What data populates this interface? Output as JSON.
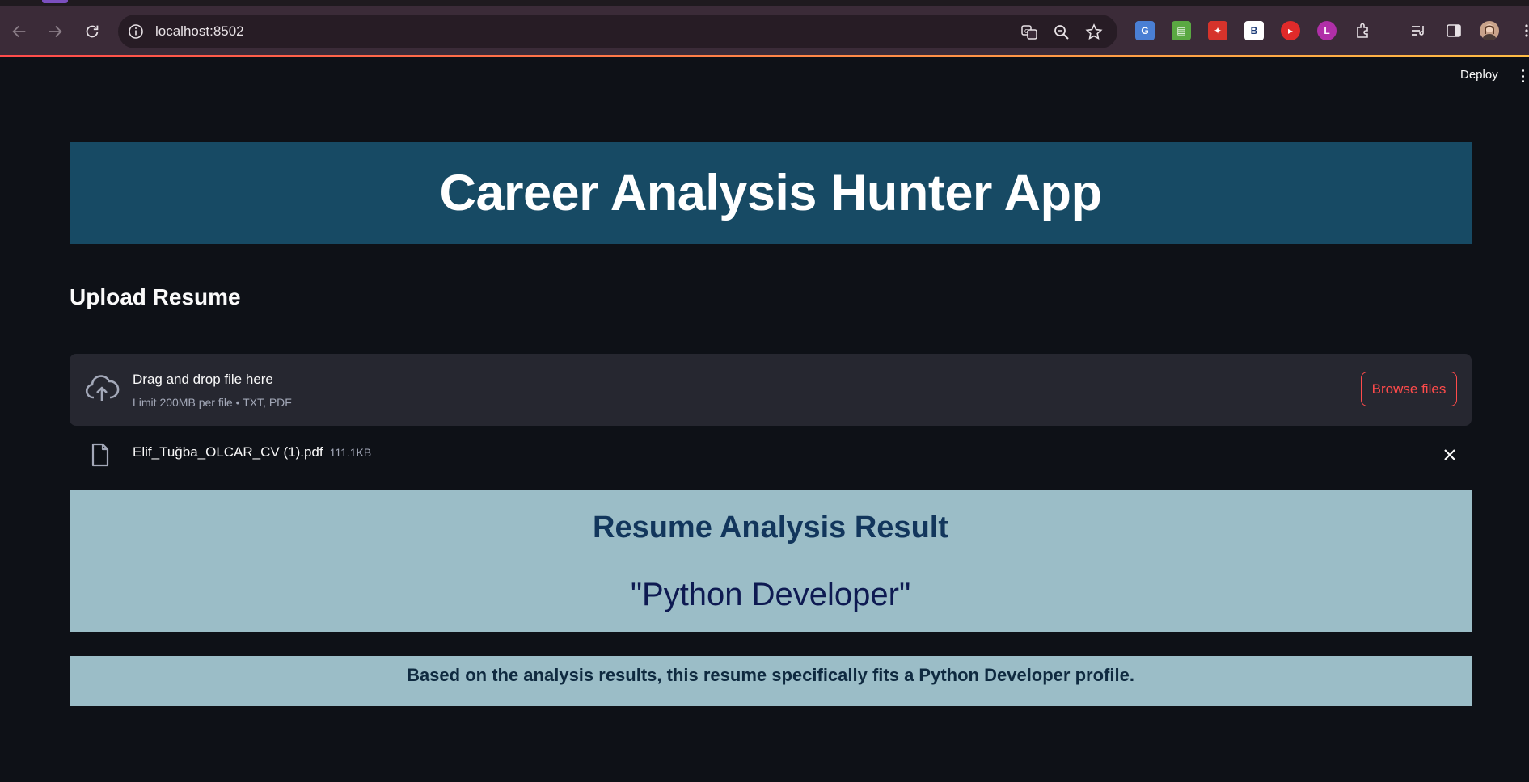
{
  "browser": {
    "url": "localhost:8502"
  },
  "header": {
    "deploy_label": "Deploy"
  },
  "app": {
    "title": "Career Analysis Hunter App",
    "upload_heading": "Upload Resume"
  },
  "uploader": {
    "drag_text": "Drag and drop file here",
    "limit_text": "Limit 200MB per file • TXT, PDF",
    "browse_label": "Browse files"
  },
  "uploaded_file": {
    "name": "Elif_Tuğba_OLCAR_CV (1).pdf",
    "size": "111.1KB"
  },
  "result": {
    "title": "Resume Analysis Result",
    "role": "\"Python Developer\"",
    "summary": "Based on the analysis results, this resume specifically fits a Python Developer profile."
  },
  "colors": {
    "background": "#0e1117",
    "banner": "#174a64",
    "result_bg": "#9bbdc7",
    "accent": "#ff4b4b"
  }
}
